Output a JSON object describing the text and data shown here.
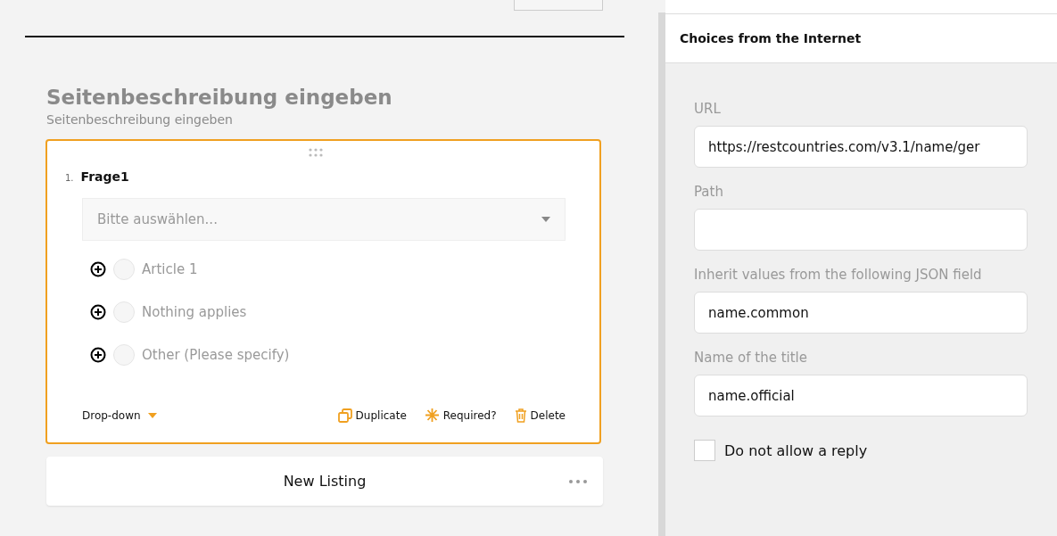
{
  "page": {
    "title": "Seitenbeschreibung eingeben",
    "description": "Seitenbeschreibung eingeben"
  },
  "question": {
    "number": "1.",
    "title": "Frage1",
    "dropdown": {
      "placeholder": "Bitte auswählen..."
    },
    "choices": [
      {
        "label": "Article 1",
        "selected": false
      },
      {
        "label": "Nothing applies",
        "selected": false
      },
      {
        "label": "Other (Please specify)",
        "selected": false
      }
    ],
    "type": "Drop-down",
    "actions": [
      {
        "kind": "duplicate",
        "label": "Duplicate"
      },
      {
        "kind": "required",
        "label": "Required?"
      },
      {
        "kind": "delete",
        "label": "Delete"
      }
    ]
  },
  "new_listing": {
    "label": "New Listing"
  },
  "panel": {
    "title": "Choices from the Internet",
    "fields": [
      {
        "label": "URL",
        "value": "https://restcountries.com/v3.1/name/ger"
      },
      {
        "label": "Path"
      },
      {
        "label": "Inherit values from the following JSON field",
        "value": "name.common"
      },
      {
        "label": "Name of the title",
        "value": "name.official"
      }
    ],
    "checkbox": {
      "label": "Do not allow a reply",
      "checked": false
    }
  }
}
